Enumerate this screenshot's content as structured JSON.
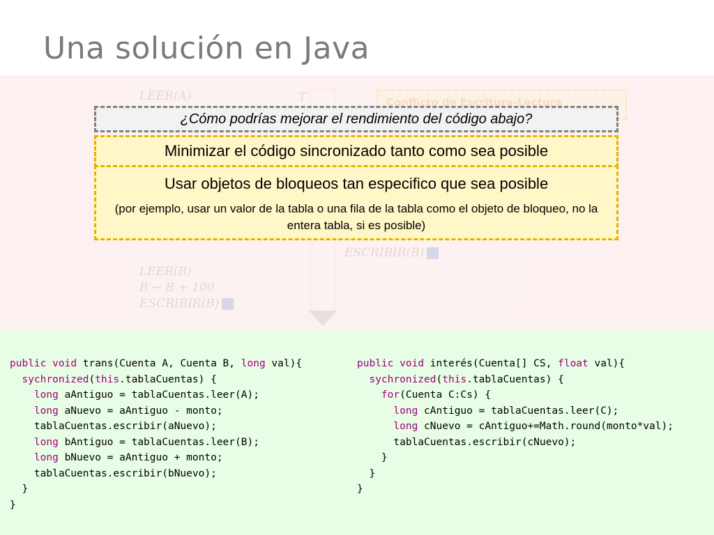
{
  "slide": {
    "title": "Una solución en Java"
  },
  "background": {
    "left_col": {
      "header": "LEER(A)",
      "step1": "LEER(B)",
      "step2": "B ← B + 100",
      "step3": "ESCRIBIR(B)"
    },
    "right_col": {
      "step3": "ESCRIBIR(B)"
    },
    "conflict_label": "Conflicto de Escritura-Lectura",
    "col_letter": "T"
  },
  "overlay": {
    "question": "¿Cómo podrías mejorar el rendimiento del código abajo?",
    "tip1": "Minimizar el código sincronizado tanto como sea posible",
    "tip2_head": "Usar objetos de bloqueos tan especifico que sea posible",
    "tip2_detail": "(por ejemplo, usar un valor de la tabla o una fila de la tabla como el objeto de bloqueo, no la entera tabla, si es posible)"
  },
  "code_left": [
    "public void trans(Cuenta A, Cuenta B, long val){",
    "  sychronized(this.tablaCuentas) {",
    "    long aAntiguo = tablaCuentas.leer(A);",
    "    long aNuevo = aAntiguo - monto;",
    "    tablaCuentas.escribir(aNuevo);",
    "    long bAntiguo = tablaCuentas.leer(B);",
    "    long bNuevo = aAntiguo + monto;",
    "    tablaCuentas.escribir(bNuevo);",
    "  }",
    "}"
  ],
  "code_right": [
    "public void interés(Cuenta[] CS, float val){",
    "  sychronized(this.tablaCuentas) {",
    "    for(Cuenta C:Cs) {",
    "      long cAntiguo = tablaCuentas.leer(C);",
    "      long cNuevo = cAntiguo+=Math.round(monto*val);",
    "      tablaCuentas.escribir(cNuevo);",
    "    }",
    "  }",
    "}"
  ],
  "colors": {
    "top_bg": "#fdf0f0",
    "bottom_bg": "#e8fde5",
    "keyword": "#a0007a",
    "dash_yellow": "#e3b300",
    "dash_gray": "#808080"
  }
}
